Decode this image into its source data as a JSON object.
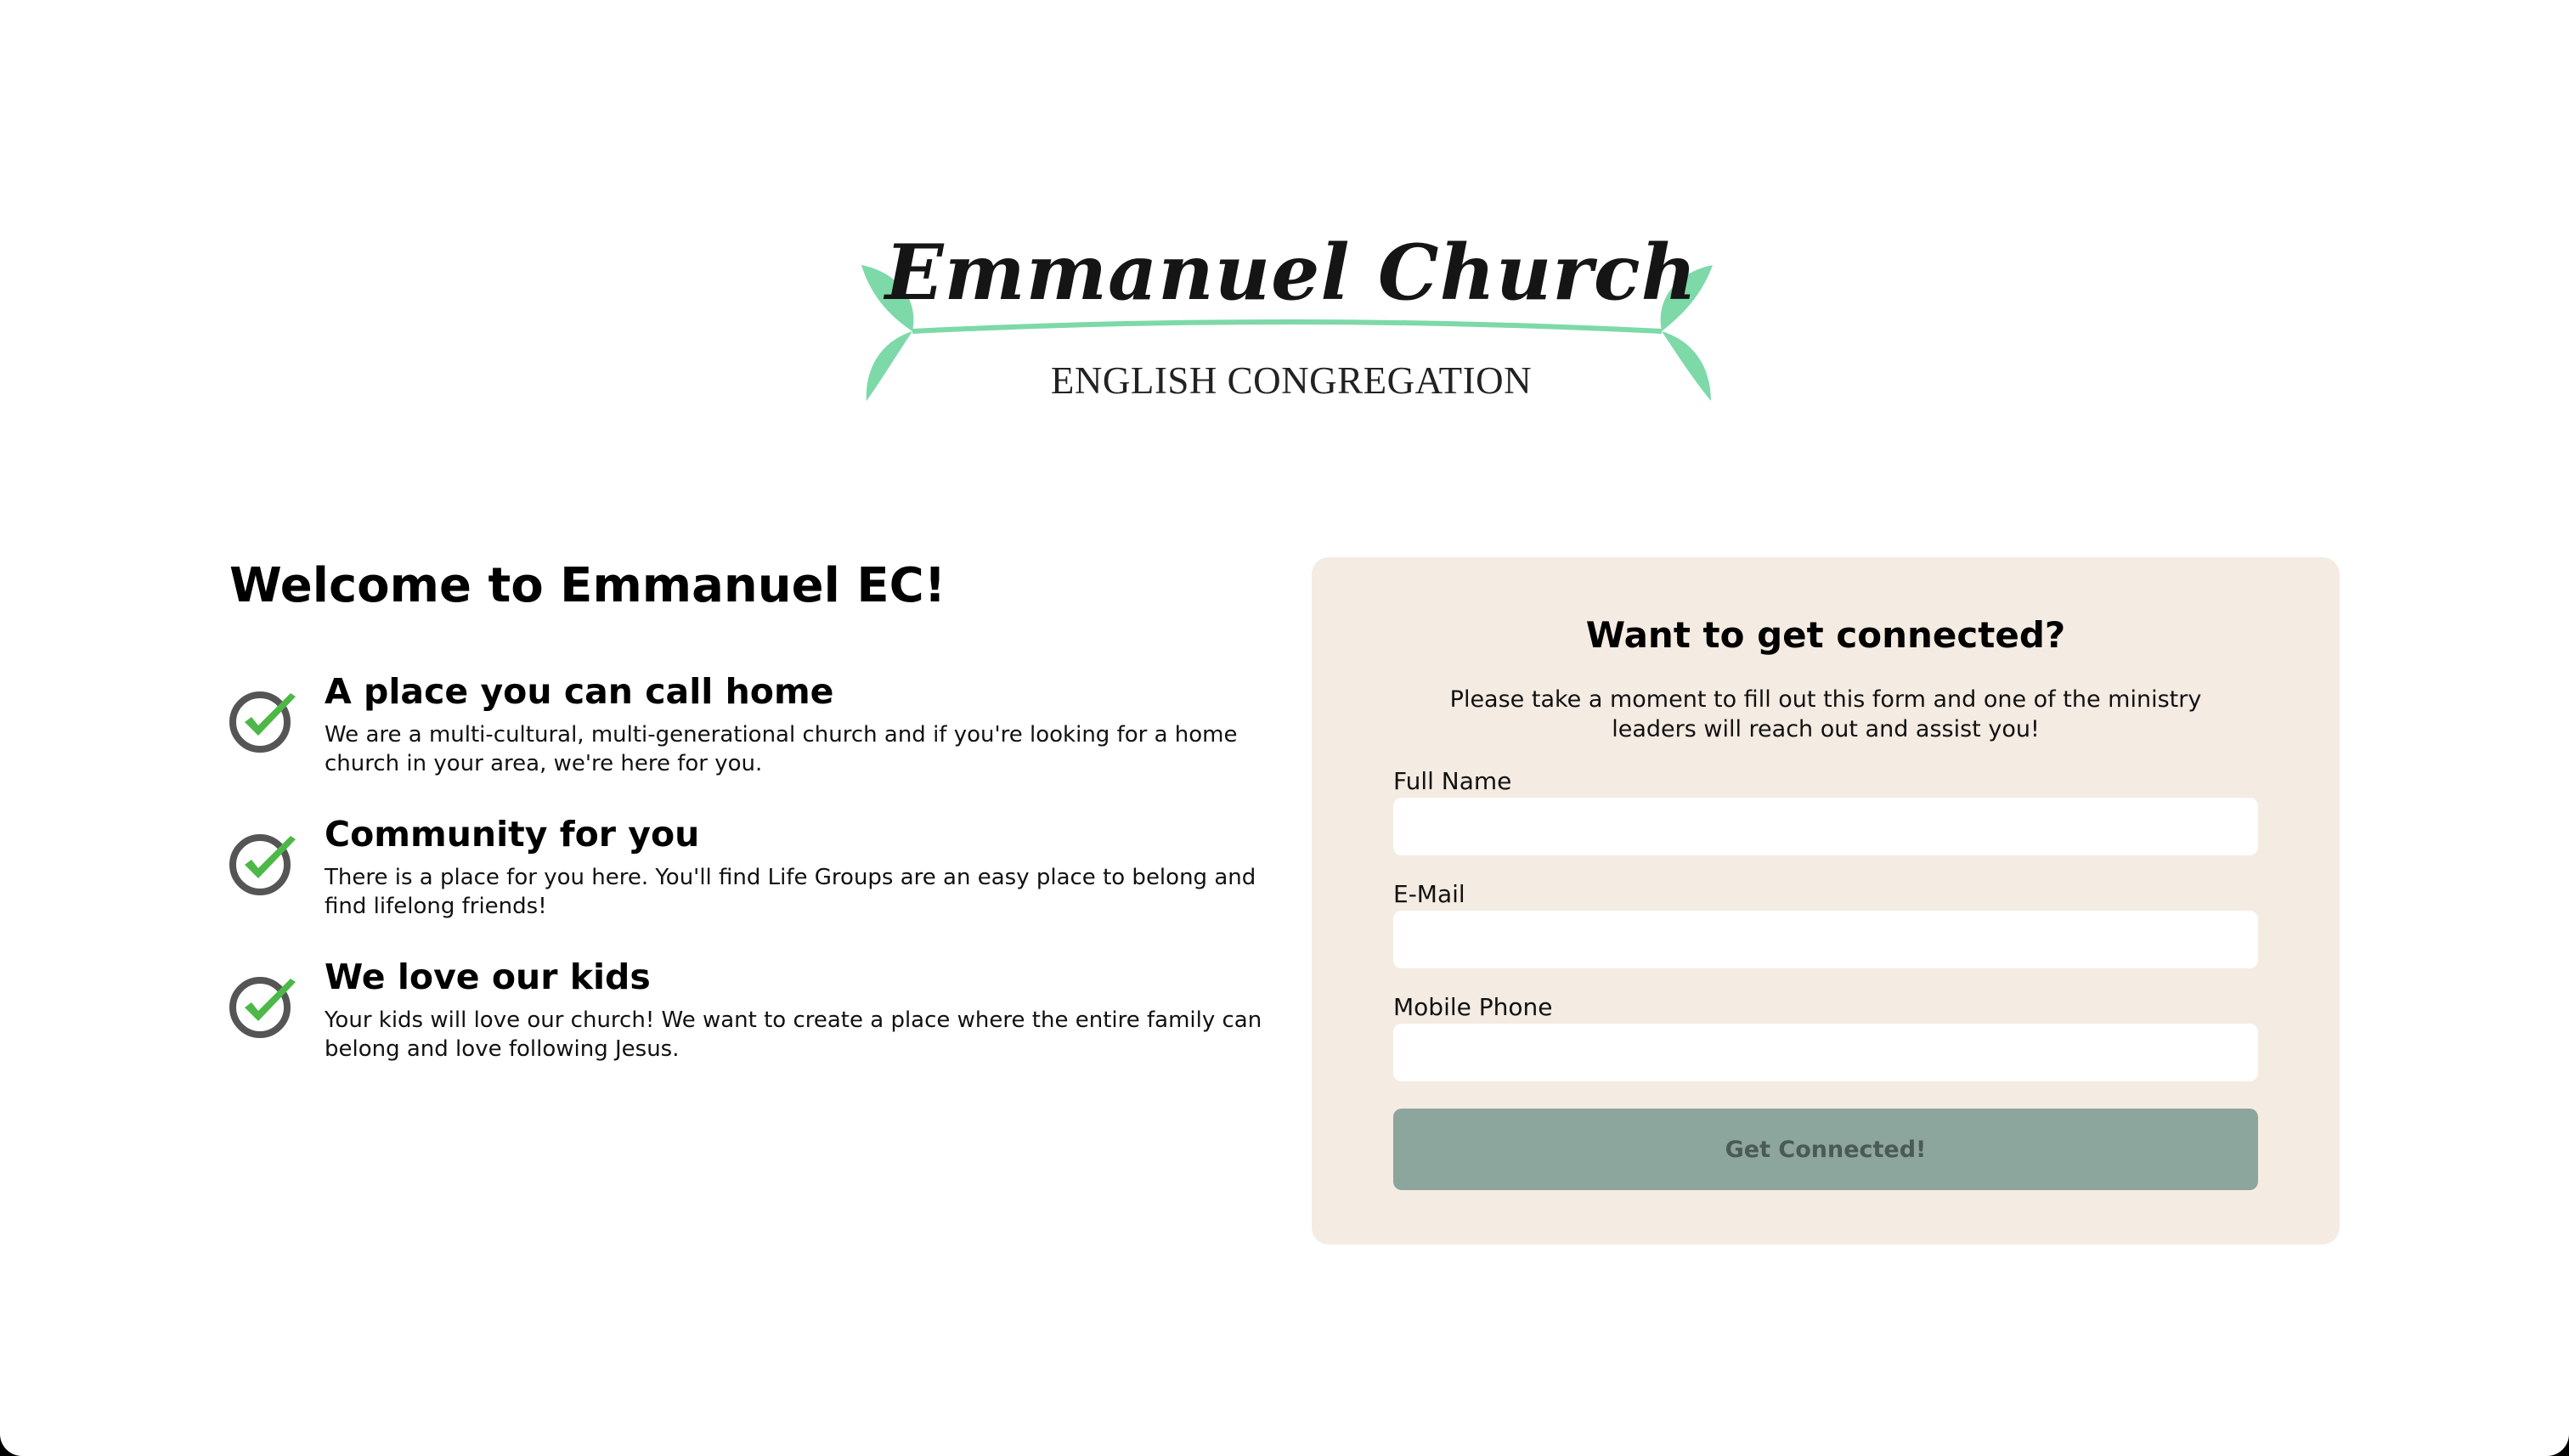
{
  "logo": {
    "title": "Emmanuel Church",
    "subtitle": "ENGLISH CONGREGATION",
    "leaf_color": "#7dd9a8"
  },
  "welcome": {
    "title": "Welcome to Emmanuel EC!"
  },
  "features": [
    {
      "icon": "check-icon",
      "title": "A place you can call home",
      "text": "We are a multi-cultural, multi-generational church and if you're looking for a home church in your area, we're here for you."
    },
    {
      "icon": "check-icon",
      "title": "Community for you",
      "text": "There is a place for you here. You'll find Life Groups are an easy place to belong and find lifelong friends!"
    },
    {
      "icon": "check-icon",
      "title": "We love our kids",
      "text": "Your kids will love our church! We want to create a place where the entire family can belong and love following Jesus."
    }
  ],
  "form": {
    "title": "Want to get connected?",
    "description": "Please take a moment to fill out this form and one of the ministry leaders will reach out and assist you!",
    "fields": [
      {
        "label": "Full Name",
        "value": "",
        "placeholder": ""
      },
      {
        "label": "E-Mail",
        "value": "",
        "placeholder": ""
      },
      {
        "label": "Mobile Phone",
        "value": "",
        "placeholder": ""
      }
    ],
    "submit_label": "Get Connected!"
  },
  "colors": {
    "card_background": "#f4ebe2",
    "button_background": "#8ca59d",
    "check_green": "#4cb848",
    "check_circle": "#555555"
  }
}
